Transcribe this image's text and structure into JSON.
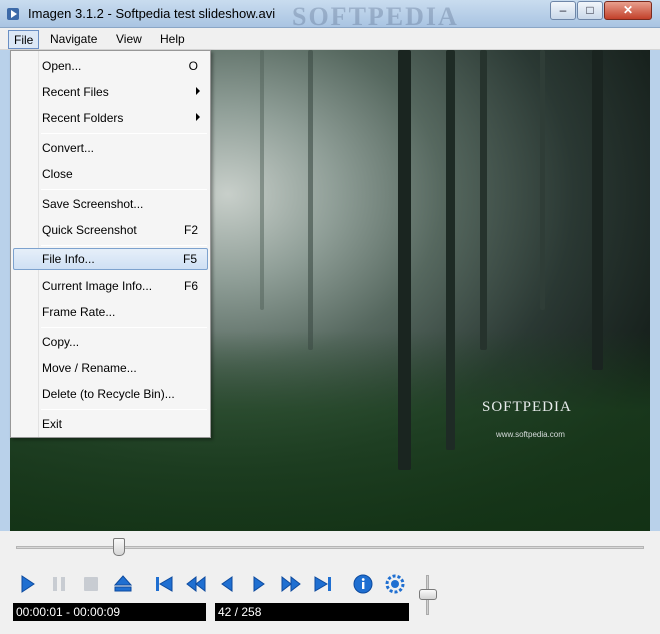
{
  "window": {
    "title": "Imagen 3.1.2 - Softpedia test slideshow.avi",
    "watermark": "SOFTPEDIA",
    "minimize_glyph": "–",
    "maximize_glyph": "□",
    "close_glyph": "✕"
  },
  "menubar": {
    "items": [
      {
        "label": "File",
        "active": true
      },
      {
        "label": "Navigate"
      },
      {
        "label": "View"
      },
      {
        "label": "Help"
      }
    ]
  },
  "file_menu": {
    "items": [
      {
        "label": "Open...",
        "shortcut": "O"
      },
      {
        "label": "Recent Files",
        "submenu": true
      },
      {
        "label": "Recent Folders",
        "submenu": true
      },
      {
        "label": "Convert..."
      },
      {
        "label": "Close"
      },
      {
        "label": "Save Screenshot..."
      },
      {
        "label": "Quick Screenshot",
        "shortcut": "F2"
      },
      {
        "label": "File Info...",
        "shortcut": "F5",
        "highlighted": true
      },
      {
        "label": "Current Image Info...",
        "shortcut": "F6"
      },
      {
        "label": "Frame Rate..."
      },
      {
        "label": "Copy..."
      },
      {
        "label": "Move / Rename..."
      },
      {
        "label": "Delete (to Recycle Bin)..."
      },
      {
        "label": "Exit"
      }
    ]
  },
  "viewer": {
    "logo_text": "SOFTPEDIA",
    "logo_url": "www.softpedia.com"
  },
  "controls": {
    "seek_position_fraction": 0.17,
    "volume_fraction": 0.6,
    "icons": [
      "play-icon",
      "pause-icon",
      "stop-icon",
      "eject-icon",
      "first-icon",
      "rewind-icon",
      "previous-icon",
      "next-icon",
      "fast-forward-icon",
      "last-icon",
      "info-icon",
      "settings-icon"
    ],
    "time_display": "00:00:01 - 00:00:09",
    "frame_display": "42 / 258"
  },
  "colors": {
    "accent_blue": "#1f6fd1",
    "selection": "#cfe0f4"
  }
}
